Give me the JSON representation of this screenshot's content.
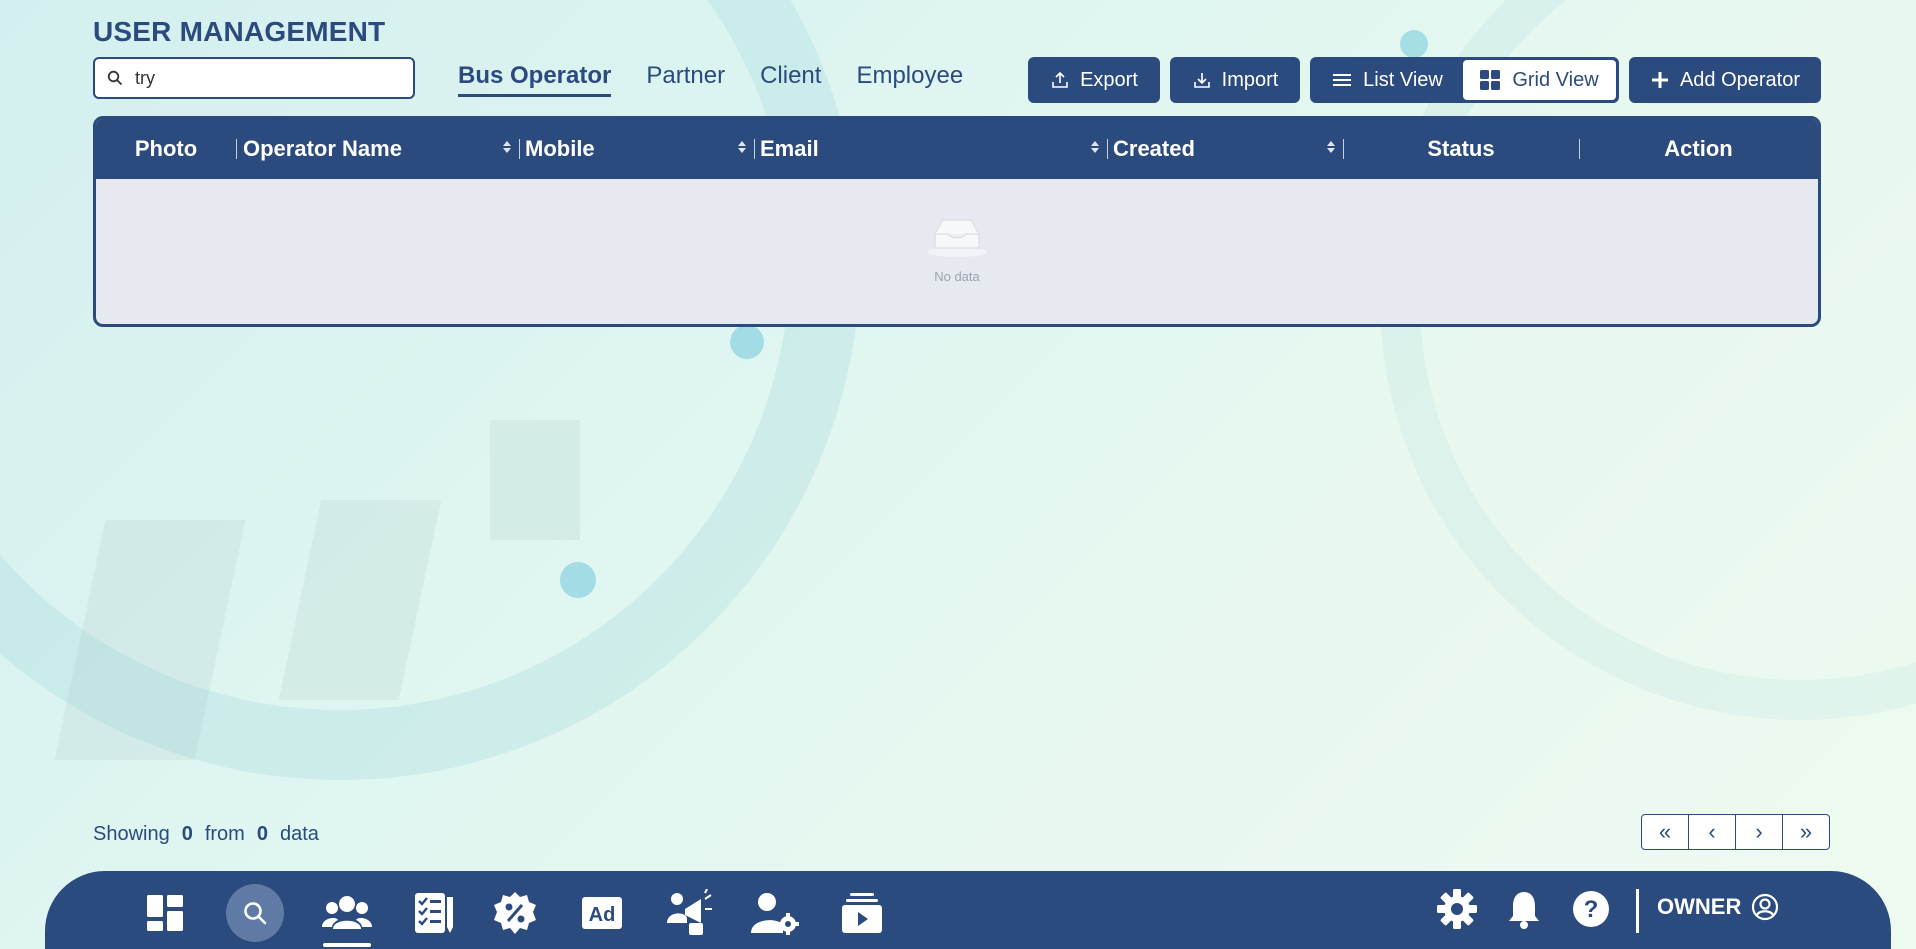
{
  "page": {
    "title": "USER MANAGEMENT"
  },
  "search": {
    "value": "try",
    "icon": "search-icon"
  },
  "tabs": [
    {
      "label": "Bus Operator",
      "active": true
    },
    {
      "label": "Partner",
      "active": false
    },
    {
      "label": "Client",
      "active": false
    },
    {
      "label": "Employee",
      "active": false
    }
  ],
  "toolbar": {
    "export_label": "Export",
    "import_label": "Import",
    "list_view_label": "List View",
    "grid_view_label": "Grid View",
    "add_label": "Add Operator",
    "active_view": "Grid View"
  },
  "table": {
    "columns": [
      {
        "label": "Photo",
        "sortable": false
      },
      {
        "label": "Operator Name",
        "sortable": true
      },
      {
        "label": "Mobile",
        "sortable": true
      },
      {
        "label": "Email",
        "sortable": true
      },
      {
        "label": "Created",
        "sortable": true
      },
      {
        "label": "Status",
        "sortable": false
      },
      {
        "label": "Action",
        "sortable": false
      }
    ],
    "rows": [],
    "empty_text": "No data"
  },
  "footer": {
    "showing_label": "Showing",
    "shown_count": "0",
    "from_label": "from",
    "total_count": "0",
    "data_label": "data"
  },
  "pagination": {
    "first": "«",
    "prev": "‹",
    "next": "›",
    "last": "»"
  },
  "bottom_nav": {
    "items": [
      "dashboard-icon",
      "search-icon",
      "users-icon",
      "checklist-icon",
      "discount-icon",
      "ad-icon",
      "promotion-icon",
      "user-settings-icon",
      "media-icon"
    ],
    "active": "users-icon",
    "user_label": "OWNER"
  },
  "colors": {
    "primary": "#2b4a7e",
    "background": "#def5f1",
    "table_body": "#e6eaf0"
  }
}
